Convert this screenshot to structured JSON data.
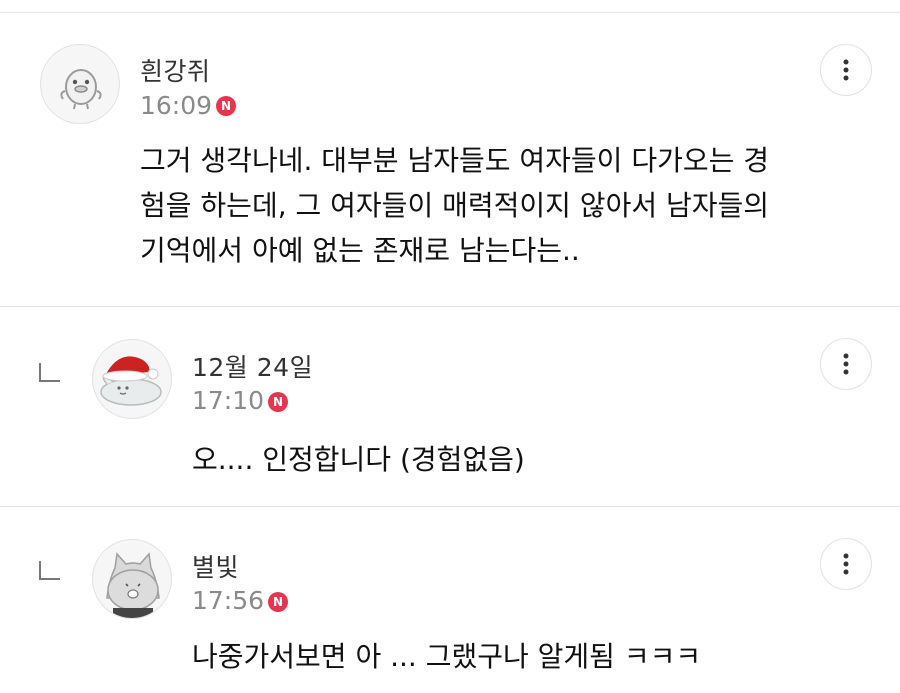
{
  "comments": [
    {
      "nickname": "흰강쥐",
      "time": "16:09",
      "badge": "N",
      "text_lines": [
        "그거 생각나네. 대부분 남자들도 여자들이 다가오는 경",
        "험을 하는데, 그 여자들이 매력적이지 않아서 남자들의",
        "기억에서 아예 없는 존재로 남는다는.."
      ]
    },
    {
      "nickname": "12월 24일",
      "time": "17:10",
      "badge": "N",
      "text_lines": [
        "오.... 인정합니다 (경험없음)"
      ],
      "is_reply": true
    },
    {
      "nickname": "별빛",
      "time": "17:56",
      "badge": "N",
      "text_lines": [
        "나중가서보면 아 ... 그랬구나 알게됨 ㅋㅋㅋ"
      ],
      "is_reply": true
    }
  ],
  "colors": {
    "badge": "#e8344e",
    "divider": "#e6e6e6",
    "meta_text": "#8a8a8a",
    "body_text": "#111111"
  },
  "icons": {
    "more": "vertical-ellipsis-icon",
    "reply": "reply-arrow-icon",
    "avatar1": "chick-avatar-icon",
    "avatar2": "santa-hat-character-avatar-icon",
    "avatar3": "cat-avatar-icon"
  }
}
